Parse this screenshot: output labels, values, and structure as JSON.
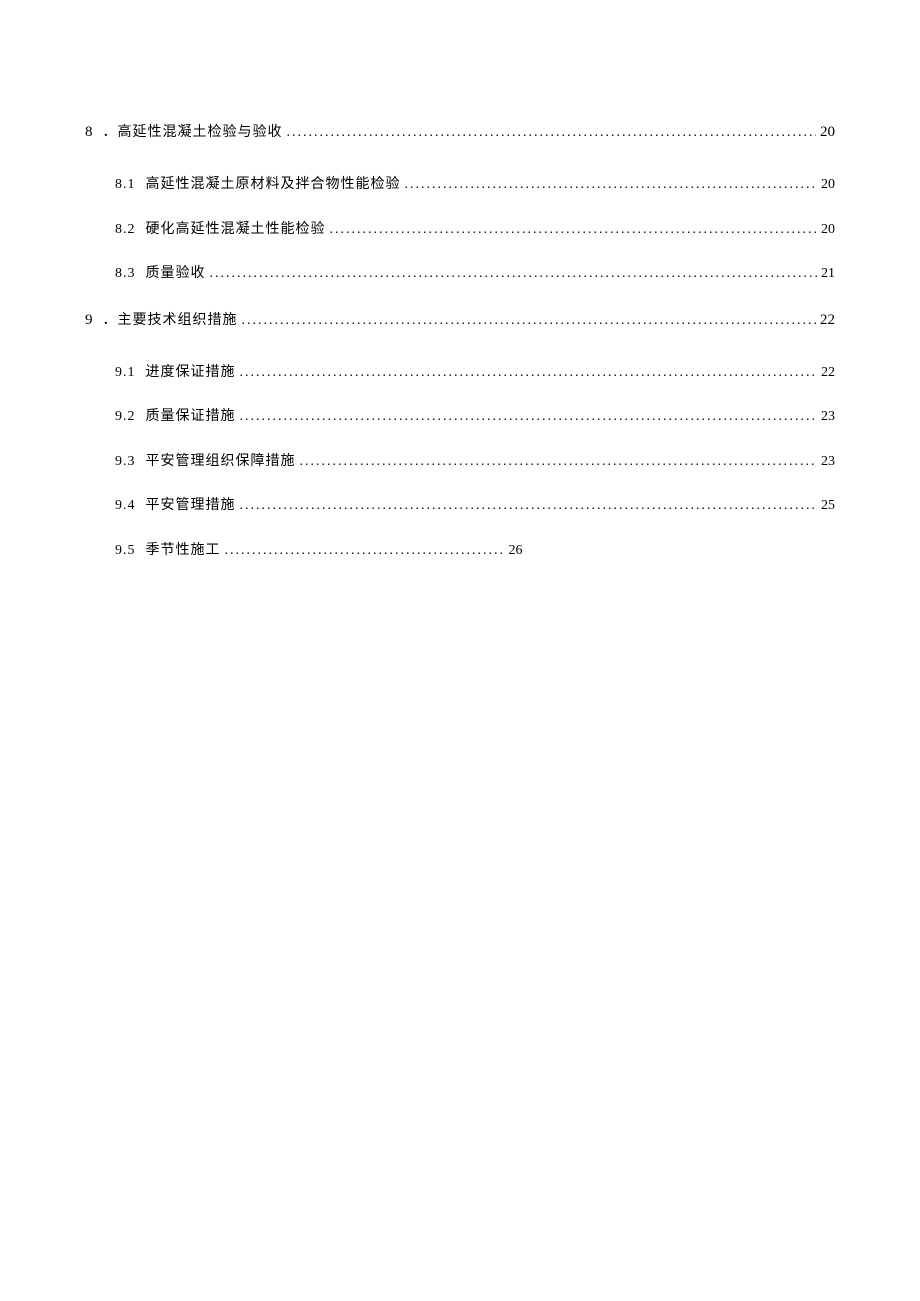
{
  "toc": [
    {
      "num": "8",
      "prefix": "．",
      "title": "高延性混凝土检验与验收",
      "page": "20",
      "level": 1,
      "children": [
        {
          "num": "8.1",
          "title": "高延性混凝土原材料及拌合物性能检验",
          "page": "20",
          "level": 2
        },
        {
          "num": "8.2",
          "title": "硬化高延性混凝土性能检验",
          "page": "20",
          "level": 2
        },
        {
          "num": "8.3",
          "title": "质量验收",
          "page": "21",
          "level": 2
        }
      ]
    },
    {
      "num": "9",
      "prefix": "．",
      "title": "主要技术组织措施",
      "page": "22",
      "level": 1,
      "children": [
        {
          "num": "9.1",
          "title": "进度保证措施",
          "page": "22",
          "level": 2
        },
        {
          "num": "9.2",
          "title": "质量保证措施",
          "page": "23",
          "level": 2
        },
        {
          "num": "9.3",
          "title": "平安管理组织保障措施",
          "page": "23",
          "level": 2
        },
        {
          "num": "9.4",
          "title": "平安管理措施",
          "page": "25",
          "level": 2
        },
        {
          "num": "9.5",
          "title": "季节性施工",
          "page": "26",
          "level": 2,
          "short": true
        }
      ]
    }
  ]
}
